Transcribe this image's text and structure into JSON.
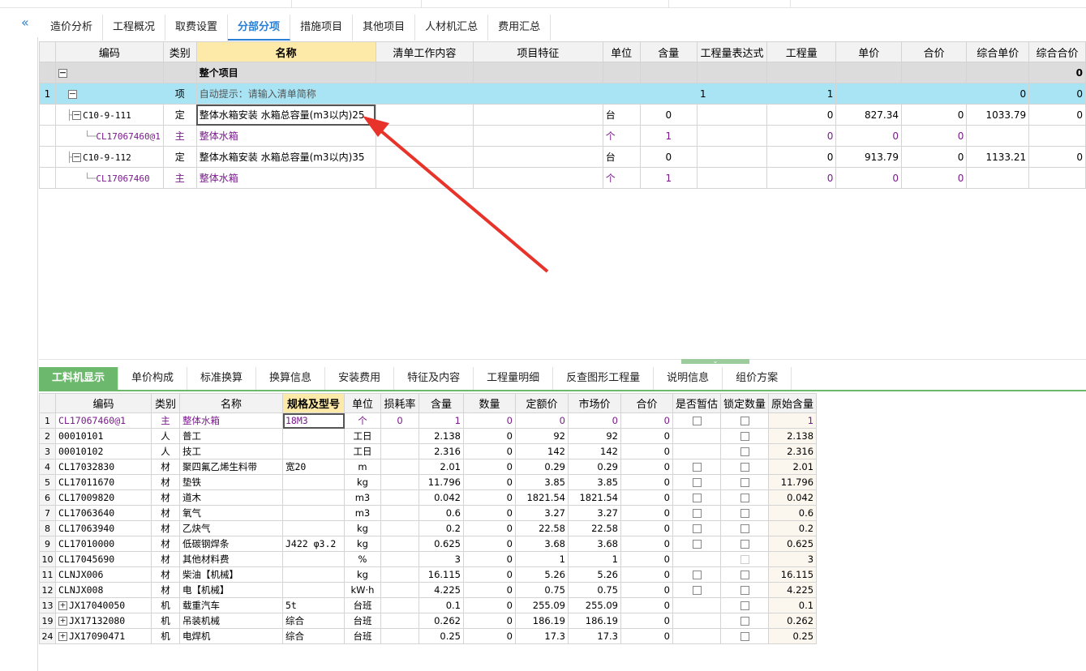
{
  "left_toggle": "«",
  "top_tabs": [
    {
      "label": "造价分析"
    },
    {
      "label": "工程概况"
    },
    {
      "label": "取费设置"
    },
    {
      "label": "分部分项",
      "active": true
    },
    {
      "label": "措施项目"
    },
    {
      "label": "其他项目"
    },
    {
      "label": "人材机汇总"
    },
    {
      "label": "费用汇总"
    }
  ],
  "upper_grid": {
    "headers": [
      "编码",
      "类别",
      "名称",
      "清单工作内容",
      "项目特征",
      "单位",
      "含量",
      "工程量表达式",
      "工程量",
      "单价",
      "合价",
      "综合单价",
      "综合合价"
    ],
    "group_row": {
      "name": "整个项目",
      "total": "0"
    },
    "item_row": {
      "no": "1",
      "type": "项",
      "name_hint": "自动提示：请输入清单简称",
      "expr": "1",
      "qty": "1",
      "amount": "0",
      "total": "0"
    },
    "rows": [
      {
        "code": "C10-9-111",
        "type": "定",
        "name": "整体水箱安装 水箱总容量(m3以内)25",
        "unit": "台",
        "content": "0",
        "qty": "0",
        "price": "827.34",
        "amount": "0",
        "comp_price": "1033.79",
        "comp_total": "0",
        "level": "quota",
        "selected": true
      },
      {
        "code": "CL17067460@1",
        "type": "主",
        "name": "整体水箱",
        "unit": "个",
        "content": "1",
        "qty": "0",
        "price": "0",
        "amount": "0",
        "comp_price": "",
        "comp_total": "",
        "level": "material"
      },
      {
        "code": "C10-9-112",
        "type": "定",
        "name": "整体水箱安装 水箱总容量(m3以内)35",
        "unit": "台",
        "content": "0",
        "qty": "0",
        "price": "913.79",
        "amount": "0",
        "comp_price": "1133.21",
        "comp_total": "0",
        "level": "quota"
      },
      {
        "code": "CL17067460",
        "type": "主",
        "name": "整体水箱",
        "unit": "个",
        "content": "1",
        "qty": "0",
        "price": "0",
        "amount": "0",
        "comp_price": "",
        "comp_total": "",
        "level": "material"
      }
    ]
  },
  "bottom_tabs": [
    {
      "label": "工料机显示",
      "active": true
    },
    {
      "label": "单价构成"
    },
    {
      "label": "标准换算"
    },
    {
      "label": "换算信息"
    },
    {
      "label": "安装费用"
    },
    {
      "label": "特征及内容"
    },
    {
      "label": "工程量明细"
    },
    {
      "label": "反查图形工程量"
    },
    {
      "label": "说明信息"
    },
    {
      "label": "组价方案"
    }
  ],
  "lower_grid": {
    "headers": [
      "编码",
      "类别",
      "名称",
      "规格及型号",
      "单位",
      "损耗率",
      "含量",
      "数量",
      "定额价",
      "市场价",
      "合价",
      "是否暂估",
      "锁定数量",
      "原始含量"
    ],
    "rows": [
      {
        "no": "1",
        "code": "CL17067460@1",
        "type": "主",
        "name": "整体水箱",
        "spec": "18M3",
        "unit": "个",
        "loss": "0",
        "content": "1",
        "qty": "0",
        "quota_price": "0",
        "market_price": "0",
        "amount": "0",
        "est": true,
        "lock": true,
        "orig": "1",
        "purple": true
      },
      {
        "no": "2",
        "code": "00010101",
        "type": "人",
        "name": "普工",
        "spec": "",
        "unit": "工日",
        "loss": "",
        "content": "2.138",
        "qty": "0",
        "quota_price": "92",
        "market_price": "92",
        "amount": "0",
        "est": false,
        "lock": true,
        "orig": "2.138"
      },
      {
        "no": "3",
        "code": "00010102",
        "type": "人",
        "name": "技工",
        "spec": "",
        "unit": "工日",
        "loss": "",
        "content": "2.316",
        "qty": "0",
        "quota_price": "142",
        "market_price": "142",
        "amount": "0",
        "est": false,
        "lock": true,
        "orig": "2.316"
      },
      {
        "no": "4",
        "code": "CL17032830",
        "type": "材",
        "name": "聚四氟乙烯生料带",
        "spec": "宽20",
        "unit": "m",
        "loss": "",
        "content": "2.01",
        "qty": "0",
        "quota_price": "0.29",
        "market_price": "0.29",
        "amount": "0",
        "est": true,
        "lock": true,
        "orig": "2.01"
      },
      {
        "no": "5",
        "code": "CL17011670",
        "type": "材",
        "name": "垫铁",
        "spec": "",
        "unit": "kg",
        "loss": "",
        "content": "11.796",
        "qty": "0",
        "quota_price": "3.85",
        "market_price": "3.85",
        "amount": "0",
        "est": true,
        "lock": true,
        "orig": "11.796"
      },
      {
        "no": "6",
        "code": "CL17009820",
        "type": "材",
        "name": "道木",
        "spec": "",
        "unit": "m3",
        "loss": "",
        "content": "0.042",
        "qty": "0",
        "quota_price": "1821.54",
        "market_price": "1821.54",
        "amount": "0",
        "est": true,
        "lock": true,
        "orig": "0.042"
      },
      {
        "no": "7",
        "code": "CL17063640",
        "type": "材",
        "name": "氧气",
        "spec": "",
        "unit": "m3",
        "loss": "",
        "content": "0.6",
        "qty": "0",
        "quota_price": "3.27",
        "market_price": "3.27",
        "amount": "0",
        "est": true,
        "lock": true,
        "orig": "0.6"
      },
      {
        "no": "8",
        "code": "CL17063940",
        "type": "材",
        "name": "乙炔气",
        "spec": "",
        "unit": "kg",
        "loss": "",
        "content": "0.2",
        "qty": "0",
        "quota_price": "22.58",
        "market_price": "22.58",
        "amount": "0",
        "est": true,
        "lock": true,
        "orig": "0.2"
      },
      {
        "no": "9",
        "code": "CL17010000",
        "type": "材",
        "name": "低碳钢焊条",
        "spec": "J422 φ3.2",
        "unit": "kg",
        "loss": "",
        "content": "0.625",
        "qty": "0",
        "quota_price": "3.68",
        "market_price": "3.68",
        "amount": "0",
        "est": true,
        "lock": true,
        "orig": "0.625"
      },
      {
        "no": "10",
        "code": "CL17045690",
        "type": "材",
        "name": "其他材料费",
        "spec": "",
        "unit": "%",
        "loss": "",
        "content": "3",
        "qty": "0",
        "quota_price": "1",
        "market_price": "1",
        "amount": "0",
        "est": false,
        "lock": "disabled",
        "orig": "3"
      },
      {
        "no": "11",
        "code": "CLNJX006",
        "type": "材",
        "name": "柴油【机械】",
        "spec": "",
        "unit": "kg",
        "loss": "",
        "content": "16.115",
        "qty": "0",
        "quota_price": "5.26",
        "market_price": "5.26",
        "amount": "0",
        "est": true,
        "lock": true,
        "orig": "16.115"
      },
      {
        "no": "12",
        "code": "CLNJX008",
        "type": "材",
        "name": "电【机械】",
        "spec": "",
        "unit": "kW·h",
        "loss": "",
        "content": "4.225",
        "qty": "0",
        "quota_price": "0.75",
        "market_price": "0.75",
        "amount": "0",
        "est": true,
        "lock": true,
        "orig": "4.225"
      },
      {
        "no": "13",
        "code": "JX17040050",
        "type": "机",
        "name": "载重汽车",
        "spec": "5t",
        "unit": "台班",
        "loss": "",
        "content": "0.1",
        "qty": "0",
        "quota_price": "255.09",
        "market_price": "255.09",
        "amount": "0",
        "est": false,
        "lock": true,
        "orig": "0.1",
        "expand": true
      },
      {
        "no": "19",
        "code": "JX17132080",
        "type": "机",
        "name": "吊装机械",
        "spec": "综合",
        "unit": "台班",
        "loss": "",
        "content": "0.262",
        "qty": "0",
        "quota_price": "186.19",
        "market_price": "186.19",
        "amount": "0",
        "est": false,
        "lock": true,
        "orig": "0.262",
        "expand": true
      },
      {
        "no": "24",
        "code": "JX17090471",
        "type": "机",
        "name": "电焊机",
        "spec": "综合",
        "unit": "台班",
        "loss": "",
        "content": "0.25",
        "qty": "0",
        "quota_price": "17.3",
        "market_price": "17.3",
        "amount": "0",
        "est": false,
        "lock": true,
        "orig": "0.25",
        "expand": true
      }
    ]
  },
  "colors": {
    "accent_blue": "#2a7fd4",
    "tab_green": "#6cb86c",
    "row_selected": "#a8e4f4",
    "header_highlight": "#fde9a8",
    "material_purple": "#7a1a8c",
    "annotation_arrow": "#e8332a"
  }
}
